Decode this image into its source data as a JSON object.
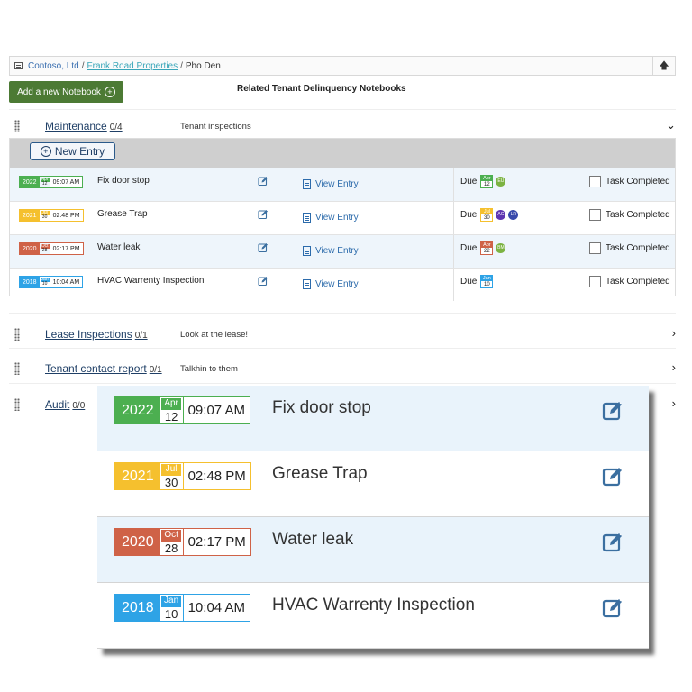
{
  "breadcrumb": {
    "company": "Contoso, Ltd",
    "sep1": "/",
    "property": "Frank Road Properties",
    "sep2": "/",
    "current": "Pho Den",
    "up_icon": "arrow-up-icon"
  },
  "toolbar": {
    "add_notebook_label": "Add a new Notebook",
    "related_title": "Related Tenant Delinquency Notebooks"
  },
  "colors": {
    "green": "#4caf50",
    "yellow": "#f5c02e",
    "red": "#cf6247",
    "blue": "#2ea3e6",
    "add_button": "#4c7a34",
    "link": "#1f3f66"
  },
  "sections": [
    {
      "title": "Maintenance",
      "count": "0/4",
      "desc": "Tenant inspections",
      "expanded": true
    },
    {
      "title": "Lease Inspections",
      "count": "0/1",
      "desc": "Look at the lease!",
      "expanded": false
    },
    {
      "title": "Tenant contact report",
      "count": "0/1",
      "desc": "Talkhin to them",
      "expanded": false
    },
    {
      "title": "Audit",
      "count": "0/0",
      "desc": "",
      "expanded": false
    }
  ],
  "maintenance": {
    "new_entry_label": "New Entry",
    "view_label": "View Entry",
    "due_label": "Due",
    "task_label": "Task Completed",
    "entries": [
      {
        "year": "2022",
        "month": "Apr",
        "day": "12",
        "time": "09:07 AM",
        "name": "Fix door stop",
        "due_month": "Apr",
        "due_day": "12",
        "assignees": [
          "EU"
        ]
      },
      {
        "year": "2021",
        "month": "Jul",
        "day": "30",
        "time": "02:48 PM",
        "name": "Grease Trap",
        "due_month": "Jul",
        "due_day": "30",
        "assignees": [
          "AC",
          "LR"
        ]
      },
      {
        "year": "2020",
        "month": "Oct",
        "day": "28",
        "time": "02:17 PM",
        "name": "Water leak",
        "due_month": "Apr",
        "due_day": "22",
        "assignees": [
          "BM"
        ]
      },
      {
        "year": "2018",
        "month": "Jan",
        "day": "10",
        "time": "10:04 AM",
        "name": "HVAC Warrenty Inspection",
        "due_month": "Jan",
        "due_day": "10",
        "assignees": []
      }
    ]
  }
}
